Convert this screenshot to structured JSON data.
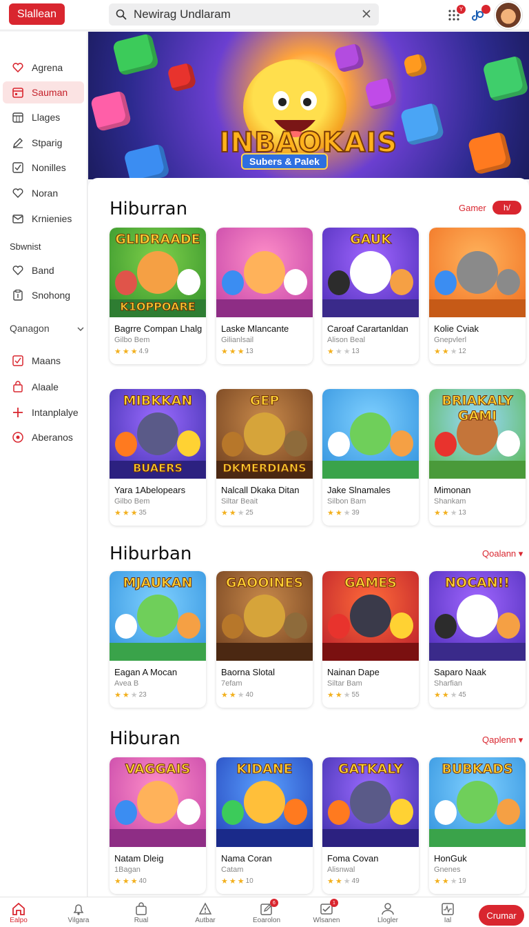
{
  "colors": {
    "accent": "#d9262f",
    "active_bg": "#fbe3e3"
  },
  "header": {
    "brand_label": "Slallean",
    "search_placeholder": "Newirag Undlaram",
    "notification_badge": "Y"
  },
  "sidebar": {
    "items_top": [
      {
        "label": "Agrena",
        "icon": "heart-icon"
      },
      {
        "label": "Sauman",
        "icon": "calendar-icon",
        "active": true
      },
      {
        "label": "Llages",
        "icon": "calendar-grid-icon"
      },
      {
        "label": "Stparig",
        "icon": "edit-icon"
      },
      {
        "label": "Nonilles",
        "icon": "check-square-icon"
      },
      {
        "label": "Noran",
        "icon": "heart-icon"
      },
      {
        "label": "Krnienies",
        "icon": "mail-icon"
      }
    ],
    "heading": "Sbwnist",
    "items_mid": [
      {
        "label": "Band",
        "icon": "heart-icon"
      },
      {
        "label": "Snohong",
        "icon": "clipboard-icon"
      }
    ],
    "section_label": "Qanagon",
    "items_bottom": [
      {
        "label": "Maans",
        "icon": "check-square-icon"
      },
      {
        "label": "Alaale",
        "icon": "bag-icon"
      },
      {
        "label": "Intanplalye",
        "icon": "plus-icon"
      },
      {
        "label": "Aberanos",
        "icon": "circle-icon"
      }
    ]
  },
  "hero": {
    "title": "INBAOKAIS",
    "subtitle": "Subers & Palek"
  },
  "sections": [
    {
      "title": "Hiburran",
      "link": "Gamer",
      "pill": "h/",
      "cards": [
        {
          "title": "Bagrre Compan Lhalg",
          "sub": "Gilbo Bem",
          "rating": "4.9",
          "stars": 3,
          "art_top": "GLIDRAADE",
          "art_bottom": "K1OPPOARE",
          "theme": "green"
        },
        {
          "title": "Laske Mlancante",
          "sub": "Gilianlsail",
          "rating": "13",
          "stars": 3,
          "art_top": "",
          "art_bottom": "",
          "theme": "pink"
        },
        {
          "title": "Caroaf Carartanldan",
          "sub": "Alison Beal",
          "rating": "13",
          "stars": 1,
          "art_top": "GAUK",
          "art_bottom": "",
          "theme": "purple"
        },
        {
          "title": "Kolie Cviak",
          "sub": "Gnepvlerl",
          "rating": "12",
          "stars": 2,
          "art_top": "",
          "art_bottom": "",
          "theme": "orange"
        }
      ]
    },
    {
      "title": "",
      "link": "",
      "pill": "",
      "cards": [
        {
          "title": "Yara 1Abelopears",
          "sub": "Gilbo Bem",
          "rating": "35",
          "stars": 3,
          "art_top": "MIBKKAN",
          "art_bottom": "BUAERS",
          "theme": "violet"
        },
        {
          "title": "Nalcall Dkaka Ditan",
          "sub": "Siltar Beait",
          "rating": "25",
          "stars": 2,
          "art_top": "GEP",
          "art_bottom": "DKMERDIANS",
          "theme": "brown"
        },
        {
          "title": "Jake Slnamales",
          "sub": "Silbon Bam",
          "rating": "39",
          "stars": 2,
          "art_top": "",
          "art_bottom": "",
          "theme": "sky"
        },
        {
          "title": "Mimonan",
          "sub": "Shankam",
          "rating": "13",
          "stars": 2,
          "art_top": "BRIAKALY GAMI",
          "art_bottom": "",
          "theme": "meadow"
        }
      ]
    },
    {
      "title": "Hiburban",
      "link": "Qoalann",
      "pill": "",
      "cards": [
        {
          "title": "Eagan A Mocan",
          "sub": "Avea B",
          "rating": "23",
          "stars": 2,
          "art_top": "MJAUKAN",
          "art_bottom": "",
          "theme": "sky"
        },
        {
          "title": "Baorna Slotal",
          "sub": "7efam",
          "rating": "40",
          "stars": 2,
          "art_top": "GAOOINES",
          "art_bottom": "",
          "theme": "brown"
        },
        {
          "title": "Nainan Dape",
          "sub": "Siltar Bam",
          "rating": "55",
          "stars": 2,
          "art_top": "GAMES",
          "art_bottom": "",
          "theme": "red"
        },
        {
          "title": "Saparo Naak",
          "sub": "Sharfian",
          "rating": "45",
          "stars": 2,
          "art_top": "NOCAN!!",
          "art_bottom": "",
          "theme": "purple"
        }
      ]
    },
    {
      "title": "Hiburan",
      "link": "Qaplenn",
      "pill": "",
      "cards": [
        {
          "title": "Natam Dleig",
          "sub": "1Bagan",
          "rating": "40",
          "stars": 3,
          "art_top": "VAGGAIS",
          "art_bottom": "",
          "theme": "pink"
        },
        {
          "title": "Nama Coran",
          "sub": "Catam",
          "rating": "10",
          "stars": 3,
          "art_top": "KIDANE",
          "art_bottom": "",
          "theme": "blue"
        },
        {
          "title": "Foma Covan",
          "sub": "Alisnwal",
          "rating": "49",
          "stars": 2,
          "art_top": "GATKALY",
          "art_bottom": "",
          "theme": "violet"
        },
        {
          "title": "HonGuk",
          "sub": "Gnenes",
          "rating": "19",
          "stars": 2,
          "art_top": "BUBKADS",
          "art_bottom": "",
          "theme": "sky"
        }
      ]
    }
  ],
  "bottom_nav": {
    "items": [
      {
        "label": "Ealpo",
        "icon": "home-icon",
        "active": true,
        "badge": ""
      },
      {
        "label": "Vilgara",
        "icon": "bell-icon",
        "badge": ""
      },
      {
        "label": "Rual",
        "icon": "bag-icon",
        "badge": ""
      },
      {
        "label": "Autbar",
        "icon": "alert-icon",
        "badge": ""
      },
      {
        "label": "Eoarolon",
        "icon": "edit-icon",
        "badge": "6"
      },
      {
        "label": "Wlsanen",
        "icon": "check-square-icon",
        "badge": "1"
      },
      {
        "label": "Llogler",
        "icon": "user-icon",
        "badge": ""
      },
      {
        "label": "Ial",
        "icon": "chart-icon",
        "badge": ""
      }
    ],
    "cta": "Crumar"
  }
}
